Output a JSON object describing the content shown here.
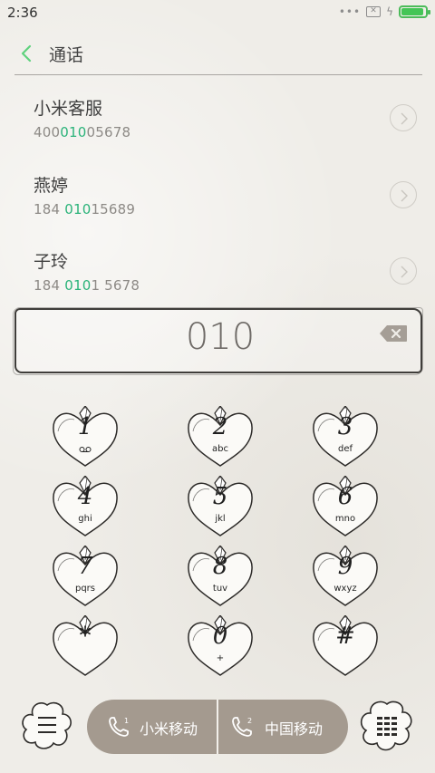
{
  "status_bar": {
    "time": "2:36",
    "battery_level": 1.0
  },
  "header": {
    "title": "通话"
  },
  "contacts": [
    {
      "name": "小米客服",
      "num_pre": "400",
      "num_hl": "010",
      "num_post": "05678"
    },
    {
      "name": "燕婷",
      "num_pre": "184 ",
      "num_hl": "010",
      "num_post": "15689"
    },
    {
      "name": "子玲",
      "num_pre": "184 ",
      "num_hl": "010",
      "num_post": "1 5678"
    }
  ],
  "dial_input": {
    "value": "010"
  },
  "keypad": [
    {
      "digit": "1",
      "letters": ""
    },
    {
      "digit": "2",
      "letters": "abc"
    },
    {
      "digit": "3",
      "letters": "def"
    },
    {
      "digit": "4",
      "letters": "ghi"
    },
    {
      "digit": "5",
      "letters": "jkl"
    },
    {
      "digit": "6",
      "letters": "mno"
    },
    {
      "digit": "7",
      "letters": "pqrs"
    },
    {
      "digit": "8",
      "letters": "tuv"
    },
    {
      "digit": "9",
      "letters": "wxyz"
    },
    {
      "digit": "*",
      "letters": ""
    },
    {
      "digit": "0",
      "letters": "+"
    },
    {
      "digit": "#",
      "letters": ""
    }
  ],
  "call_buttons": [
    {
      "label": "小米移动",
      "sim": "1"
    },
    {
      "label": "中国移动",
      "sim": "2"
    }
  ],
  "colors": {
    "accent": "#2bb37a",
    "call_bar": "#a49a8f",
    "battery": "#44c556"
  }
}
